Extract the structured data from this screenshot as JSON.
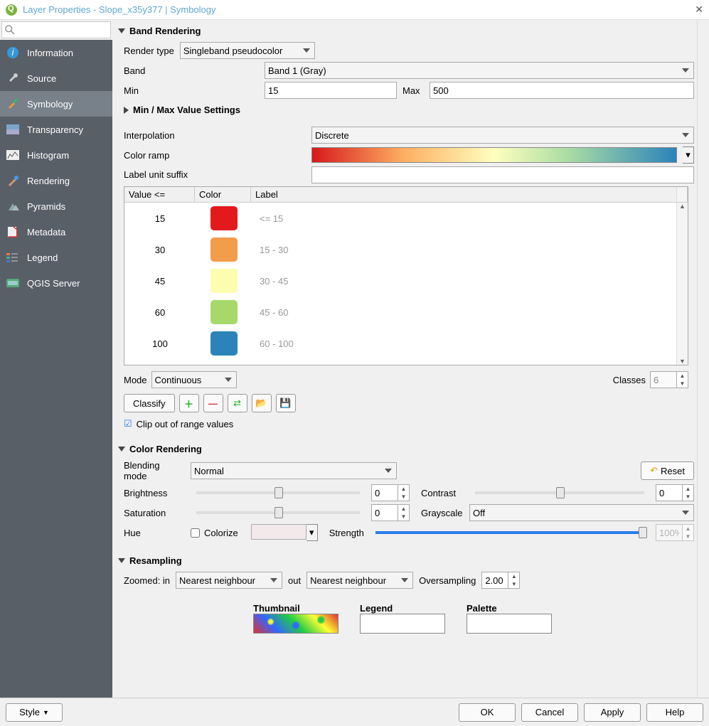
{
  "window": {
    "title": "Layer Properties - Slope_x35y377 | Symbology"
  },
  "sidebar": {
    "items": [
      {
        "label": "Information"
      },
      {
        "label": "Source"
      },
      {
        "label": "Symbology"
      },
      {
        "label": "Transparency"
      },
      {
        "label": "Histogram"
      },
      {
        "label": "Rendering"
      },
      {
        "label": "Pyramids"
      },
      {
        "label": "Metadata"
      },
      {
        "label": "Legend"
      },
      {
        "label": "QGIS Server"
      }
    ]
  },
  "band_rendering": {
    "heading": "Band Rendering",
    "render_type_label": "Render type",
    "render_type_value": "Singleband pseudocolor",
    "band_label": "Band",
    "band_value": "Band 1 (Gray)",
    "min_label": "Min",
    "min_value": "15",
    "max_label": "Max",
    "max_value": "500",
    "minmax_heading": "Min / Max Value Settings",
    "interpolation_label": "Interpolation",
    "interpolation_value": "Discrete",
    "color_ramp_label": "Color ramp",
    "label_suffix_label": "Label unit suffix",
    "label_suffix_value": "",
    "table_headers": {
      "value": "Value <=",
      "color": "Color",
      "label": "Label"
    },
    "classes": [
      {
        "value": "15",
        "color": "#e31a1c",
        "label": "<= 15"
      },
      {
        "value": "30",
        "color": "#f39c4a",
        "label": "15 - 30"
      },
      {
        "value": "45",
        "color": "#fdfdb0",
        "label": "30 - 45"
      },
      {
        "value": "60",
        "color": "#a6d96a",
        "label": "45 - 60"
      },
      {
        "value": "100",
        "color": "#2b83ba",
        "label": "60 - 100"
      }
    ],
    "mode_label": "Mode",
    "mode_value": "Continuous",
    "classes_label": "Classes",
    "classes_value": "6",
    "classify_label": "Classify",
    "clip_label": "Clip out of range values"
  },
  "color_rendering": {
    "heading": "Color Rendering",
    "blending_label": "Blending mode",
    "blending_value": "Normal",
    "reset_label": "Reset",
    "brightness_label": "Brightness",
    "brightness_value": "0",
    "contrast_label": "Contrast",
    "contrast_value": "0",
    "saturation_label": "Saturation",
    "saturation_value": "0",
    "grayscale_label": "Grayscale",
    "grayscale_value": "Off",
    "hue_label": "Hue",
    "colorize_label": "Colorize",
    "strength_label": "Strength",
    "strength_value": "100%"
  },
  "resampling": {
    "heading": "Resampling",
    "zoomed_label": "Zoomed: in",
    "in_value": "Nearest neighbour",
    "out_label": "out",
    "out_value": "Nearest neighbour",
    "oversampling_label": "Oversampling",
    "oversampling_value": "2.00",
    "thumbnail_label": "Thumbnail",
    "legend_label": "Legend",
    "palette_label": "Palette"
  },
  "footer": {
    "style_label": "Style",
    "ok": "OK",
    "cancel": "Cancel",
    "apply": "Apply",
    "help": "Help"
  }
}
